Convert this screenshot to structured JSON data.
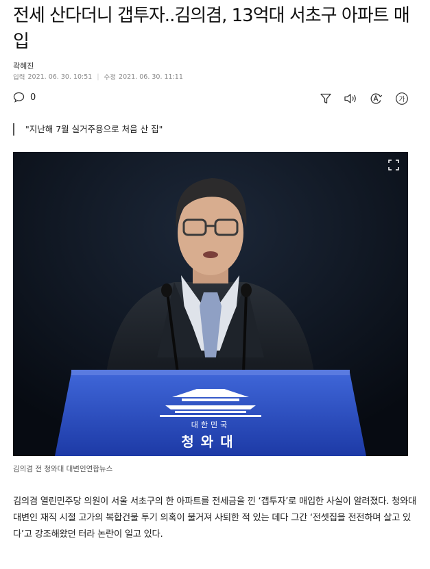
{
  "article": {
    "headline": "전세 산다더니 갭투자..김의겸, 13억대 서초구 아파트 매입",
    "author": "곽혜진",
    "input_label": "입력",
    "input_date": "2021. 06. 30. 10:51",
    "edit_label": "수정",
    "edit_date": "2021. 06. 30. 11:11",
    "comment_count": "0",
    "subheading": "\"지난해 7월 실거주용으로 처음 산 집\"",
    "photo_caption": "김의겸 전 청와대 대변인연합뉴스",
    "podium_text_small": "대한민국",
    "podium_text_large": "청와대",
    "body": "김의겸 열린민주당 의원이 서울 서초구의 한 아파트를 전세금을 낀 ‘갭투자’로 매입한 사실이 알려졌다. 청와대 대변인 재직 시절 고가의 복합건물 투기 의혹이 불거져 사퇴한 적 있는 데다 그간 ‘전셋집을 전전하며 살고 있다’고 강조해왔던 터라 논란이 일고 있다."
  },
  "toolbar": {
    "filter_icon": "filter-icon",
    "audio_icon": "speaker-icon",
    "translate_icon": "translate-icon",
    "font_icon": "font-size-icon",
    "font_glyph": "가"
  },
  "colors": {
    "podium_blue": "#2a4fc4",
    "backdrop": "#0d1522"
  }
}
